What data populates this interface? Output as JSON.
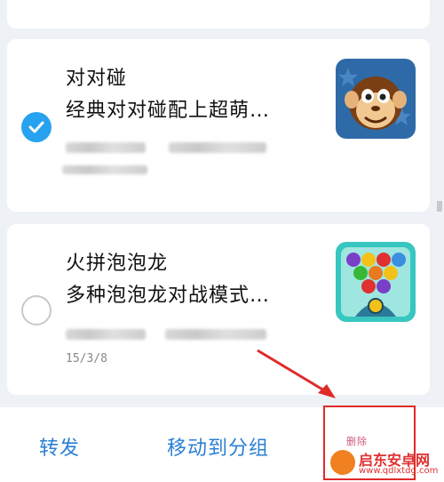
{
  "messages": [
    {
      "title": "对对碰",
      "description": "经典对对碰配上超萌…",
      "selected": true,
      "date": "",
      "thumbnail_icon": "monkey-game-icon"
    },
    {
      "title": "火拼泡泡龙",
      "description": "多种泡泡龙对战模式…",
      "selected": false,
      "date": "15/3/8",
      "thumbnail_icon": "bubble-shooter-game-icon"
    }
  ],
  "bottom_bar": {
    "forward_label": "转发",
    "move_label": "移动到分组",
    "more_label": "删除"
  },
  "colors": {
    "accent": "#27a2ee",
    "action_text": "#2a7fd4",
    "highlight": "#e02a2a",
    "background": "#eef2f6"
  },
  "watermark": {
    "brand": "启东安卓网",
    "url": "www.qdlxtdg.com"
  }
}
